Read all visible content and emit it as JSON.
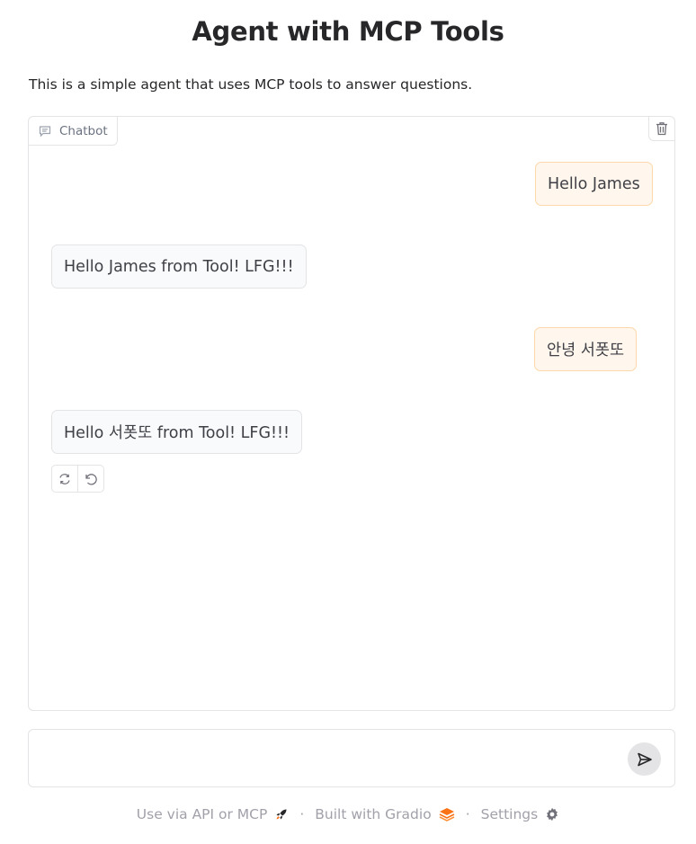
{
  "header": {
    "title": "Agent with MCP Tools",
    "description": "This is a simple agent that uses MCP tools to answer questions."
  },
  "chatbot": {
    "label": "Chatbot",
    "messages": [
      {
        "role": "user",
        "text": "Hello James"
      },
      {
        "role": "assistant",
        "text": "Hello James from Tool! LFG!!!"
      },
      {
        "role": "user",
        "text": "안녕 서폿또"
      },
      {
        "role": "assistant",
        "text": "Hello 서폿또 from Tool! LFG!!!"
      }
    ]
  },
  "input": {
    "value": "",
    "placeholder": ""
  },
  "footer": {
    "api_label": "Use via API or MCP",
    "built_label": "Built with Gradio",
    "settings_label": "Settings",
    "separator": "·"
  },
  "colors": {
    "user_bubble": "#fff7ed",
    "user_border": "#fed7aa",
    "bot_bubble": "#f9fafb",
    "border": "#e4e4e7",
    "gradio_orange": "#f97316"
  }
}
